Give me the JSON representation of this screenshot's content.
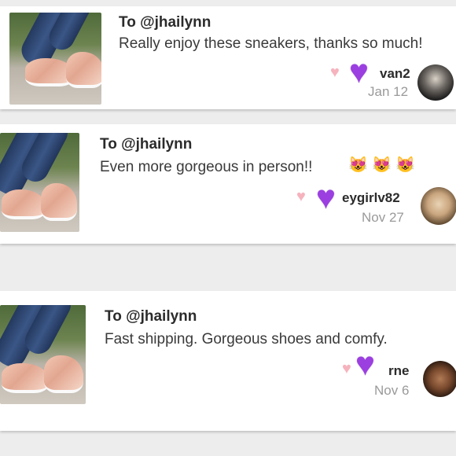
{
  "comments": [
    {
      "to": "To @jhailynn",
      "message": "Really enjoy these sneakers, thanks so much!",
      "username": "van2",
      "date": "Jan 12",
      "emojis": []
    },
    {
      "to": "To @jhailynn",
      "message": "Even more gorgeous in person!!",
      "username": "eygirlv82",
      "date": "Nov 27",
      "emojis": [
        "😻",
        "😻",
        "😻"
      ]
    },
    {
      "to": "To @jhailynn",
      "message": "Fast shipping. Gorgeous shoes and comfy.",
      "username": "rne",
      "date": "Nov 6",
      "emojis": []
    }
  ],
  "icons": {
    "like": "heart-icon",
    "overlay": "purple-heart-icon"
  },
  "colors": {
    "background": "#ededed",
    "card": "#ffffff",
    "light_heart": "#f6b3bd",
    "purple_heart": "#9b3fe0",
    "date_text": "#9a9a9a"
  }
}
